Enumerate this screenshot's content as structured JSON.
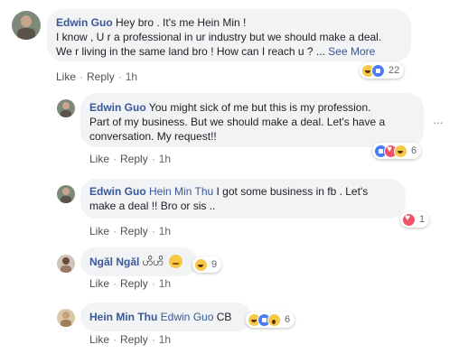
{
  "comments": [
    {
      "author": "Edwin Guo",
      "line1": "Hey bro .  It's me Hein Min !",
      "line2": "I know , U r a professional in ur industry but we should make a deal.",
      "line3": "We r living in the same land bro ! How can I reach u ? ...",
      "see_more": "See More",
      "reaction_icons": [
        "haha-icon",
        "like-icon"
      ],
      "reaction_count": "22",
      "like": "Like",
      "reply": "Reply",
      "time": "1h"
    },
    {
      "author": "Edwin Guo",
      "line1": "You might sick of me but this is my profession.",
      "line2": "Part of my business. But we should make a deal. Let's have a",
      "line3": "conversation. My request!!",
      "reaction_icons": [
        "like-icon",
        "love-icon",
        "haha-icon"
      ],
      "reaction_count": "6",
      "like": "Like",
      "reply": "Reply",
      "time": "1h"
    },
    {
      "author": "Edwin Guo",
      "mention": "Hein Min Thu",
      "line1": "I got some business in fb . Let's",
      "line2": "make a deal !! Bro or sis ..",
      "reaction_icons": [
        "love-icon"
      ],
      "reaction_count": "1",
      "like": "Like",
      "reply": "Reply",
      "time": "1h"
    },
    {
      "author": "Ngăl Ngăl",
      "text": "ဟိဟိ",
      "reaction_icons": [
        "haha-icon"
      ],
      "reaction_count": "9",
      "like": "Like",
      "reply": "Reply",
      "time": "1h"
    },
    {
      "author": "Hein Min Thu",
      "mention": "Edwin Guo",
      "text": "CB",
      "reaction_icons": [
        "haha-icon",
        "like-icon",
        "wow-icon"
      ],
      "reaction_count": "6",
      "like": "Like",
      "reply": "Reply",
      "time": "1h"
    }
  ],
  "options_icon": "···",
  "colors": {
    "link": "#385898",
    "bubble": "#f2f3f5",
    "meta": "#606770"
  }
}
